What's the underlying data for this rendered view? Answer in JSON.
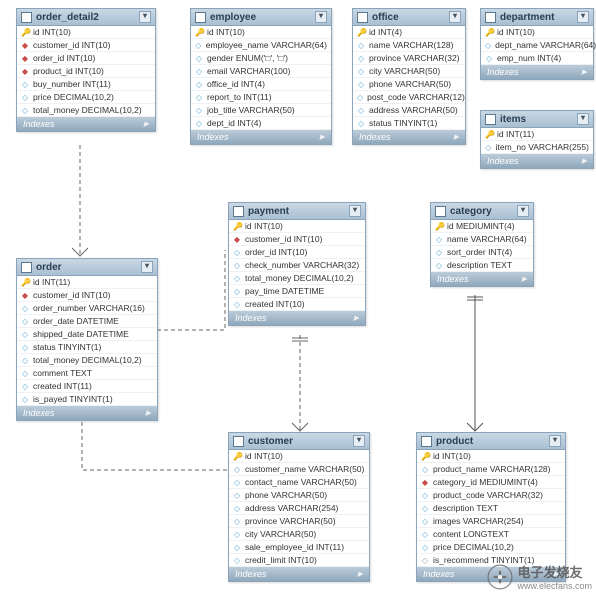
{
  "tables": {
    "order_detail2": {
      "name": "order_detail2",
      "columns": [
        {
          "mark": "key",
          "glyph": "🔑",
          "text": "id INT(10)"
        },
        {
          "mark": "fk",
          "glyph": "◆",
          "text": "customer_id INT(10)"
        },
        {
          "mark": "fk",
          "glyph": "◆",
          "text": "order_id INT(10)"
        },
        {
          "mark": "fk",
          "glyph": "◆",
          "text": "product_id INT(10)"
        },
        {
          "mark": "col",
          "glyph": "◇",
          "text": "buy_number INT(11)"
        },
        {
          "mark": "col",
          "glyph": "◇",
          "text": "price DECIMAL(10,2)"
        },
        {
          "mark": "col",
          "glyph": "◇",
          "text": "total_money DECIMAL(10,2)"
        }
      ],
      "indexes_label": "Indexes"
    },
    "employee": {
      "name": "employee",
      "columns": [
        {
          "mark": "key",
          "glyph": "🔑",
          "text": "id INT(10)"
        },
        {
          "mark": "col",
          "glyph": "◇",
          "text": "employee_name VARCHAR(64)"
        },
        {
          "mark": "col",
          "glyph": "◇",
          "text": "gender ENUM('□', '□')"
        },
        {
          "mark": "col",
          "glyph": "◇",
          "text": "email VARCHAR(100)"
        },
        {
          "mark": "col",
          "glyph": "◇",
          "text": "office_id INT(4)"
        },
        {
          "mark": "col",
          "glyph": "◇",
          "text": "report_to INT(11)"
        },
        {
          "mark": "col",
          "glyph": "◇",
          "text": "job_title VARCHAR(50)"
        },
        {
          "mark": "col",
          "glyph": "◇",
          "text": "dept_id INT(4)"
        }
      ],
      "indexes_label": "Indexes"
    },
    "office": {
      "name": "office",
      "columns": [
        {
          "mark": "key",
          "glyph": "🔑",
          "text": "id INT(4)"
        },
        {
          "mark": "col",
          "glyph": "◇",
          "text": "name VARCHAR(128)"
        },
        {
          "mark": "col",
          "glyph": "◇",
          "text": "province VARCHAR(32)"
        },
        {
          "mark": "col",
          "glyph": "◇",
          "text": "city VARCHAR(50)"
        },
        {
          "mark": "col",
          "glyph": "◇",
          "text": "phone VARCHAR(50)"
        },
        {
          "mark": "col",
          "glyph": "◇",
          "text": "post_code VARCHAR(12)"
        },
        {
          "mark": "col",
          "glyph": "◇",
          "text": "address VARCHAR(50)"
        },
        {
          "mark": "col",
          "glyph": "◇",
          "text": "status TINYINT(1)"
        }
      ],
      "indexes_label": "Indexes"
    },
    "department": {
      "name": "department",
      "columns": [
        {
          "mark": "key",
          "glyph": "🔑",
          "text": "id INT(10)"
        },
        {
          "mark": "col",
          "glyph": "◇",
          "text": "dept_name VARCHAR(64)"
        },
        {
          "mark": "col",
          "glyph": "◇",
          "text": "emp_num INT(4)"
        }
      ],
      "indexes_label": "Indexes"
    },
    "items": {
      "name": "items",
      "columns": [
        {
          "mark": "key",
          "glyph": "🔑",
          "text": "id INT(11)"
        },
        {
          "mark": "col",
          "glyph": "◇",
          "text": "item_no VARCHAR(255)"
        }
      ],
      "indexes_label": "Indexes"
    },
    "payment": {
      "name": "payment",
      "columns": [
        {
          "mark": "key",
          "glyph": "🔑",
          "text": "id INT(10)"
        },
        {
          "mark": "fk",
          "glyph": "◆",
          "text": "customer_id INT(10)"
        },
        {
          "mark": "col",
          "glyph": "◇",
          "text": "order_id INT(10)"
        },
        {
          "mark": "col",
          "glyph": "◇",
          "text": "check_number VARCHAR(32)"
        },
        {
          "mark": "col",
          "glyph": "◇",
          "text": "total_money DECIMAL(10,2)"
        },
        {
          "mark": "col",
          "glyph": "◇",
          "text": "pay_time DATETIME"
        },
        {
          "mark": "col",
          "glyph": "◇",
          "text": "created INT(10)"
        }
      ],
      "indexes_label": "Indexes"
    },
    "category": {
      "name": "category",
      "columns": [
        {
          "mark": "key",
          "glyph": "🔑",
          "text": "id MEDIUMINT(4)"
        },
        {
          "mark": "col",
          "glyph": "◇",
          "text": "name VARCHAR(64)"
        },
        {
          "mark": "col",
          "glyph": "◇",
          "text": "sort_order INT(4)"
        },
        {
          "mark": "col",
          "glyph": "◇",
          "text": "description TEXT"
        }
      ],
      "indexes_label": "Indexes"
    },
    "order": {
      "name": "order",
      "columns": [
        {
          "mark": "key",
          "glyph": "🔑",
          "text": "id INT(11)"
        },
        {
          "mark": "fk",
          "glyph": "◆",
          "text": "customer_id INT(10)"
        },
        {
          "mark": "col",
          "glyph": "◇",
          "text": "order_number VARCHAR(16)"
        },
        {
          "mark": "col",
          "glyph": "◇",
          "text": "order_date DATETIME"
        },
        {
          "mark": "col",
          "glyph": "◇",
          "text": "shipped_date DATETIME"
        },
        {
          "mark": "col",
          "glyph": "◇",
          "text": "status TINYINT(1)"
        },
        {
          "mark": "col",
          "glyph": "◇",
          "text": "total_money DECIMAL(10,2)"
        },
        {
          "mark": "col",
          "glyph": "◇",
          "text": "comment TEXT"
        },
        {
          "mark": "col",
          "glyph": "◇",
          "text": "created INT(11)"
        },
        {
          "mark": "col",
          "glyph": "◇",
          "text": "is_payed TINYINT(1)"
        }
      ],
      "indexes_label": "Indexes"
    },
    "customer": {
      "name": "customer",
      "columns": [
        {
          "mark": "key",
          "glyph": "🔑",
          "text": "id INT(10)"
        },
        {
          "mark": "col",
          "glyph": "◇",
          "text": "customer_name VARCHAR(50)"
        },
        {
          "mark": "col",
          "glyph": "◇",
          "text": "contact_name VARCHAR(50)"
        },
        {
          "mark": "col",
          "glyph": "◇",
          "text": "phone VARCHAR(50)"
        },
        {
          "mark": "col",
          "glyph": "◇",
          "text": "address VARCHAR(254)"
        },
        {
          "mark": "col",
          "glyph": "◇",
          "text": "province VARCHAR(50)"
        },
        {
          "mark": "col",
          "glyph": "◇",
          "text": "city VARCHAR(50)"
        },
        {
          "mark": "col",
          "glyph": "◇",
          "text": "sale_employee_id INT(11)"
        },
        {
          "mark": "col",
          "glyph": "◇",
          "text": "credit_limit INT(10)"
        }
      ],
      "indexes_label": "Indexes"
    },
    "product": {
      "name": "product",
      "columns": [
        {
          "mark": "key",
          "glyph": "🔑",
          "text": "id INT(10)"
        },
        {
          "mark": "col",
          "glyph": "◇",
          "text": "product_name VARCHAR(128)"
        },
        {
          "mark": "fk",
          "glyph": "◆",
          "text": "category_id MEDIUMINT(4)"
        },
        {
          "mark": "col",
          "glyph": "◇",
          "text": "product_code VARCHAR(32)"
        },
        {
          "mark": "col",
          "glyph": "◇",
          "text": "description TEXT"
        },
        {
          "mark": "col",
          "glyph": "◇",
          "text": "images VARCHAR(254)"
        },
        {
          "mark": "col",
          "glyph": "◇",
          "text": "content LONGTEXT"
        },
        {
          "mark": "col",
          "glyph": "◇",
          "text": "price DECIMAL(10,2)"
        },
        {
          "mark": "gray",
          "glyph": "◇",
          "text": "is_recommend TINYINT(1)"
        }
      ],
      "indexes_label": "Indexes"
    }
  },
  "watermark": {
    "site": "www.elecfans.com",
    "brand": "电子发烧友"
  }
}
